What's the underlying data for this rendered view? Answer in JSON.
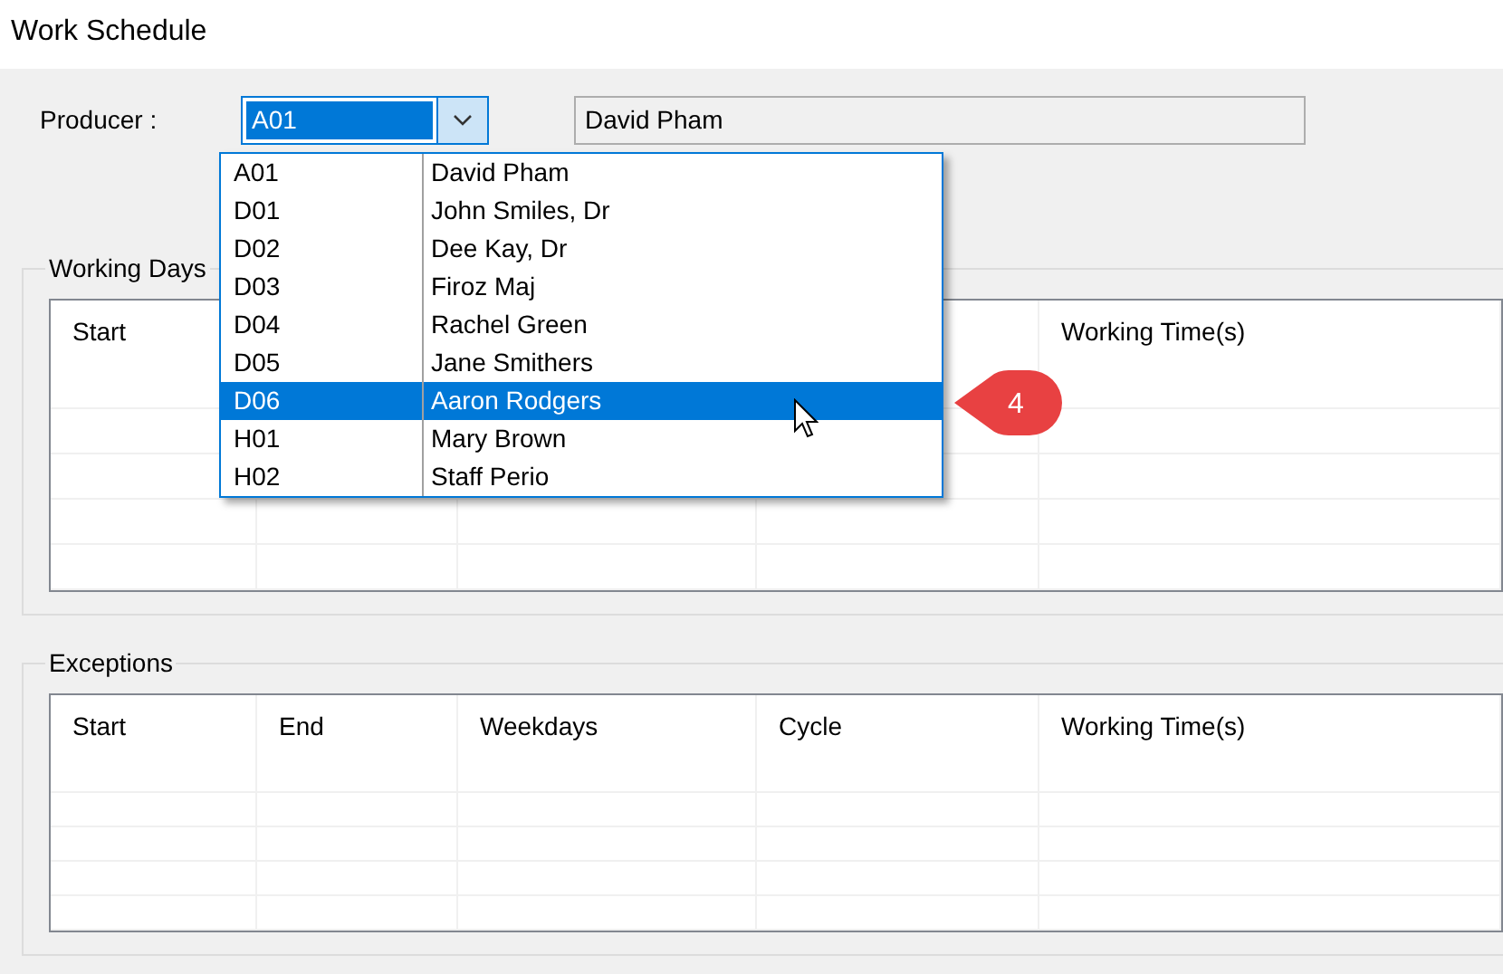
{
  "window": {
    "title": "Work Schedule"
  },
  "producer": {
    "label": "Producer :",
    "code": "A01",
    "name": "David Pham"
  },
  "dropdown": {
    "expanded": true,
    "items": [
      {
        "code": "A01",
        "name": "David Pham",
        "selected": false
      },
      {
        "code": "D01",
        "name": "John Smiles, Dr",
        "selected": false
      },
      {
        "code": "D02",
        "name": "Dee Kay, Dr",
        "selected": false
      },
      {
        "code": "D03",
        "name": "Firoz Maj",
        "selected": false
      },
      {
        "code": "D04",
        "name": "Rachel Green",
        "selected": false
      },
      {
        "code": "D05",
        "name": "Jane Smithers",
        "selected": false
      },
      {
        "code": "D06",
        "name": "Aaron Rodgers",
        "selected": true
      },
      {
        "code": "H01",
        "name": "Mary Brown",
        "selected": false
      },
      {
        "code": "H02",
        "name": "Staff Perio",
        "selected": false
      }
    ]
  },
  "callout": "4",
  "working_days": {
    "title": "Working Days",
    "columns": [
      "Start",
      "Working Time(s)"
    ]
  },
  "exceptions": {
    "title": "Exceptions",
    "columns": [
      "Start",
      "End",
      "Weekdays",
      "Cycle",
      "Working Time(s)"
    ]
  }
}
